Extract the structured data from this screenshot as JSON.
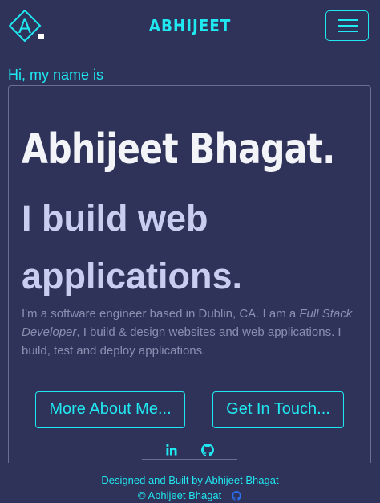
{
  "colors": {
    "background": "#2f335a",
    "accent": "#20e8f0",
    "heading": "#f3f4f8",
    "tagline": "#c9cdef",
    "body_text": "#8a8fb0"
  },
  "nav": {
    "logo_letter": "A",
    "brand": "ABHIJEET",
    "menu_icon": "hamburger-icon"
  },
  "hero": {
    "greeting": "Hi, my name is",
    "name": "Abhijeet Bhagat.",
    "tagline": "I build web applications.",
    "bio_part1": "I'm a software engineer based in Dublin, CA. I am a ",
    "bio_emphasis": "Full Stack Developer",
    "bio_part2": ", I build & design websites and web applications. I build, test and deploy applications.",
    "buttons": {
      "about": "More About Me...",
      "contact": "Get In Touch..."
    }
  },
  "social": {
    "icons": [
      "linkedin-icon",
      "github-icon"
    ]
  },
  "footer": {
    "credit": "Designed and Built by Abhijeet Bhagat",
    "copyright": "© Abhijeet Bhagat",
    "icon": "github-icon"
  }
}
